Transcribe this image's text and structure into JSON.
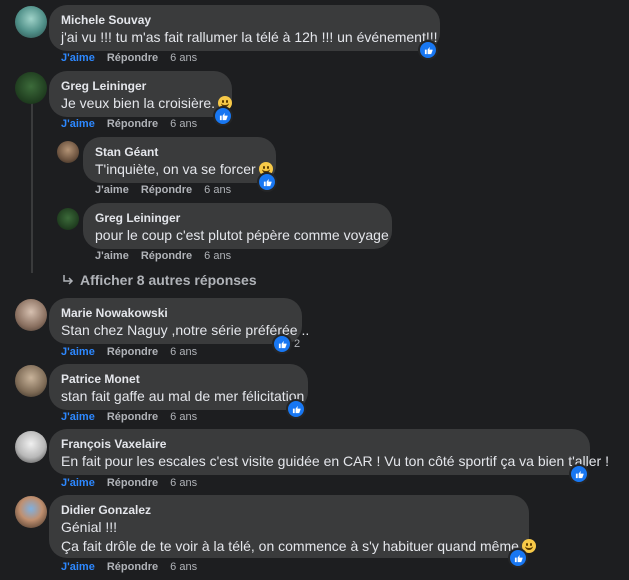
{
  "comments": [
    {
      "author": "Michele Souvay",
      "text": "j'ai vu !!! tu m'as fait rallumer la télé à 12h !!! un événement!!!",
      "like": "J'aime",
      "reply": "Répondre",
      "time": "6 ans",
      "reaction_count": ""
    },
    {
      "author": "Greg Leininger",
      "text": "Je veux bien la croisière.",
      "like": "J'aime",
      "reply": "Répondre",
      "time": "6 ans",
      "reaction_count": ""
    },
    {
      "author": "Stan Géant",
      "text": "T'inquiète, on va se forcer",
      "like": "J'aime",
      "reply": "Répondre",
      "time": "6 ans",
      "reaction_count": ""
    },
    {
      "author": "Greg Leininger",
      "text": "pour le coup c'est plutot pépère comme voyage",
      "like": "J'aime",
      "reply": "Répondre",
      "time": "6 ans",
      "reaction_count": ""
    },
    {
      "author": "Marie Nowakowski",
      "text": "Stan chez Naguy ,notre série préférée ..",
      "like": "J'aime",
      "reply": "Répondre",
      "time": "6 ans",
      "reaction_count": "2"
    },
    {
      "author": "Patrice Monet",
      "text": "stan fait gaffe au mal de mer félicitation",
      "like": "J'aime",
      "reply": "Répondre",
      "time": "6 ans",
      "reaction_count": ""
    },
    {
      "author": "François Vaxelaire",
      "text": "En fait pour les escales c'est visite guidée en CAR ! Vu ton côté sportif ça va bien t'aller !",
      "like": "J'aime",
      "reply": "Répondre",
      "time": "6 ans",
      "reaction_count": ""
    },
    {
      "author": "Didier Gonzalez",
      "text": "Génial !!!",
      "text2": "Ça fait drôle de te voir à la télé, on commence à s'y habituer quand même",
      "like": "J'aime",
      "reply": "Répondre",
      "time": "6 ans",
      "reaction_count": ""
    }
  ],
  "more_replies": "Afficher 8 autres réponses",
  "colors": {
    "background": "#1d1e20",
    "bubble": "#3a3b3c",
    "like_blue": "#2d88ff",
    "text": "#e4e6eb",
    "muted": "#b0b3b8"
  },
  "icons": [
    "like-icon",
    "smile-emoji-icon",
    "reply-arrow-icon",
    "avatar"
  ]
}
